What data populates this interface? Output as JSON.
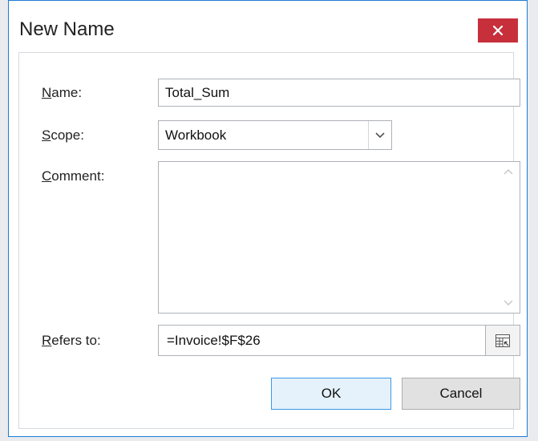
{
  "dialog": {
    "title": "New Name",
    "close_icon": "close-icon"
  },
  "fields": {
    "name": {
      "label_prefix": "",
      "label_mnemonic": "N",
      "label_rest": "ame:",
      "value": "Total_Sum"
    },
    "scope": {
      "label_mnemonic": "S",
      "label_rest": "cope:",
      "value": "Workbook",
      "arrow_icon": "chevron-down-icon"
    },
    "comment": {
      "label_mnemonic": "C",
      "label_rest": "omment:",
      "value": "",
      "scroll_up_icon": "chevron-up-icon",
      "scroll_down_icon": "chevron-down-icon"
    },
    "refers_to": {
      "label_mnemonic": "R",
      "label_rest": "efers to:",
      "value": "=Invoice!$F$26",
      "range_icon": "range-select-icon"
    }
  },
  "buttons": {
    "ok": "OK",
    "cancel": "Cancel"
  },
  "colors": {
    "close_button": "#c7303b",
    "window_border": "#1e7bd4"
  }
}
